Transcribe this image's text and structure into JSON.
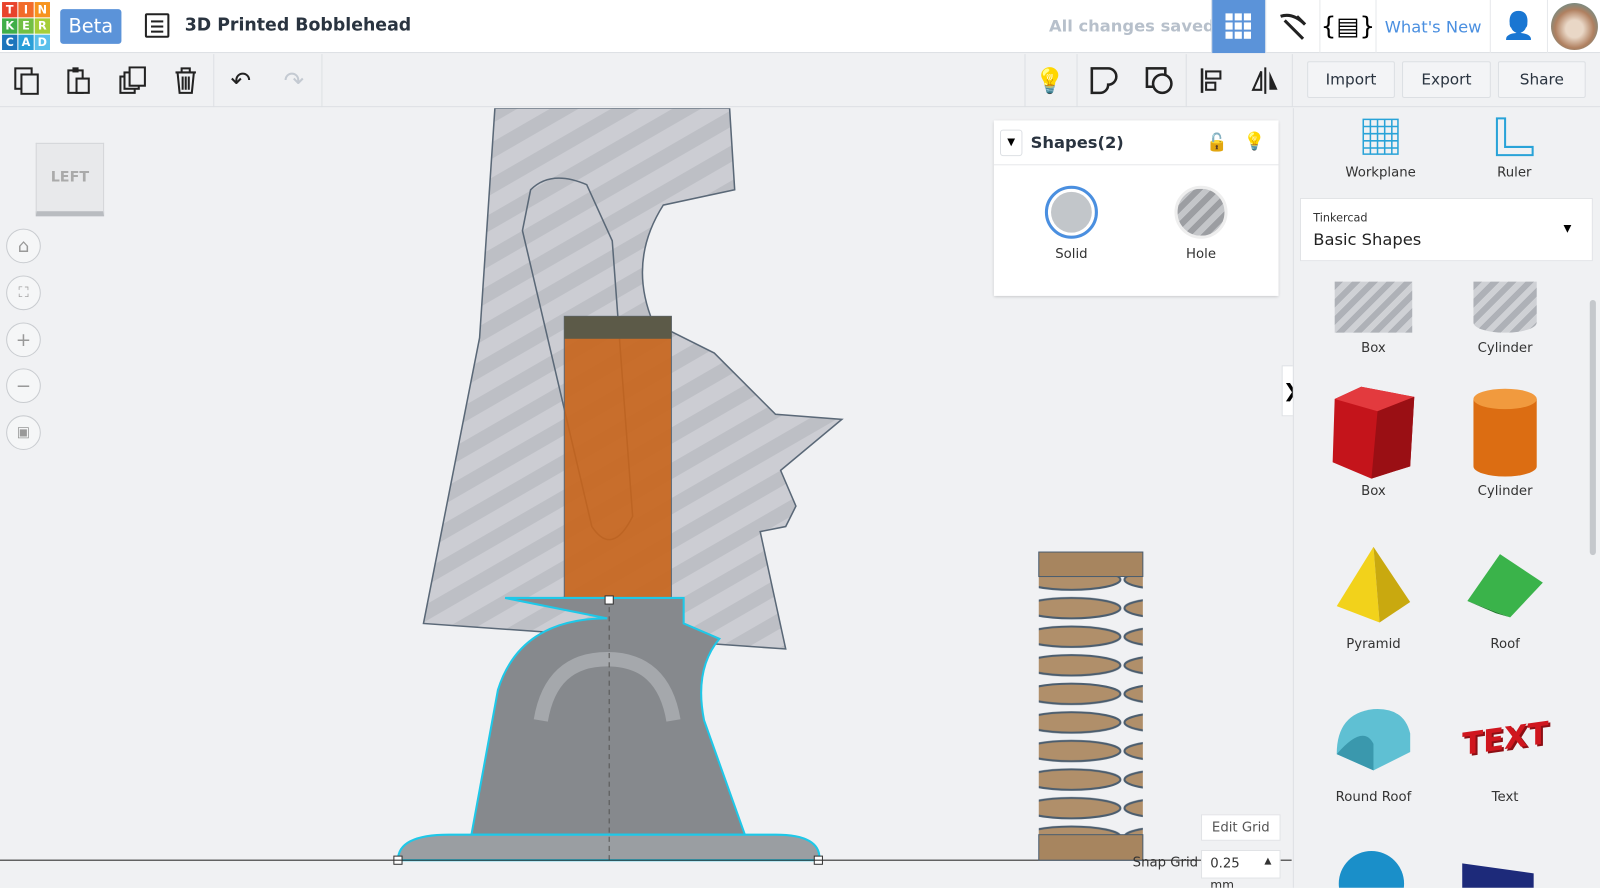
{
  "header": {
    "logo_letters": [
      "T",
      "I",
      "N",
      "K",
      "E",
      "R",
      "C",
      "A",
      "D"
    ],
    "beta": "Beta",
    "title": "3D Printed Bobblehead",
    "status": "All changes saved",
    "whats_new": "What's New"
  },
  "toolbar": {
    "import": "Import",
    "export": "Export",
    "share": "Share"
  },
  "viewcube": "LEFT",
  "inspector": {
    "title": "Shapes(2)",
    "solid": "Solid",
    "hole": "Hole"
  },
  "grid": {
    "edit": "Edit Grid",
    "snap_label": "Snap Grid",
    "snap_value": "0.25",
    "snap_unit": "mm"
  },
  "panel": {
    "workplane": "Workplane",
    "ruler": "Ruler",
    "library_small": "Tinkercad",
    "library": "Basic Shapes",
    "shapes": [
      {
        "label": "Box"
      },
      {
        "label": "Cylinder"
      },
      {
        "label": "Box"
      },
      {
        "label": "Cylinder"
      },
      {
        "label": "Pyramid"
      },
      {
        "label": "Roof"
      },
      {
        "label": "Round Roof"
      },
      {
        "label": "Text"
      }
    ]
  },
  "colors": {
    "accent": "#5b93d9",
    "selection": "#1ec8e8",
    "orange": "#c8641a"
  }
}
